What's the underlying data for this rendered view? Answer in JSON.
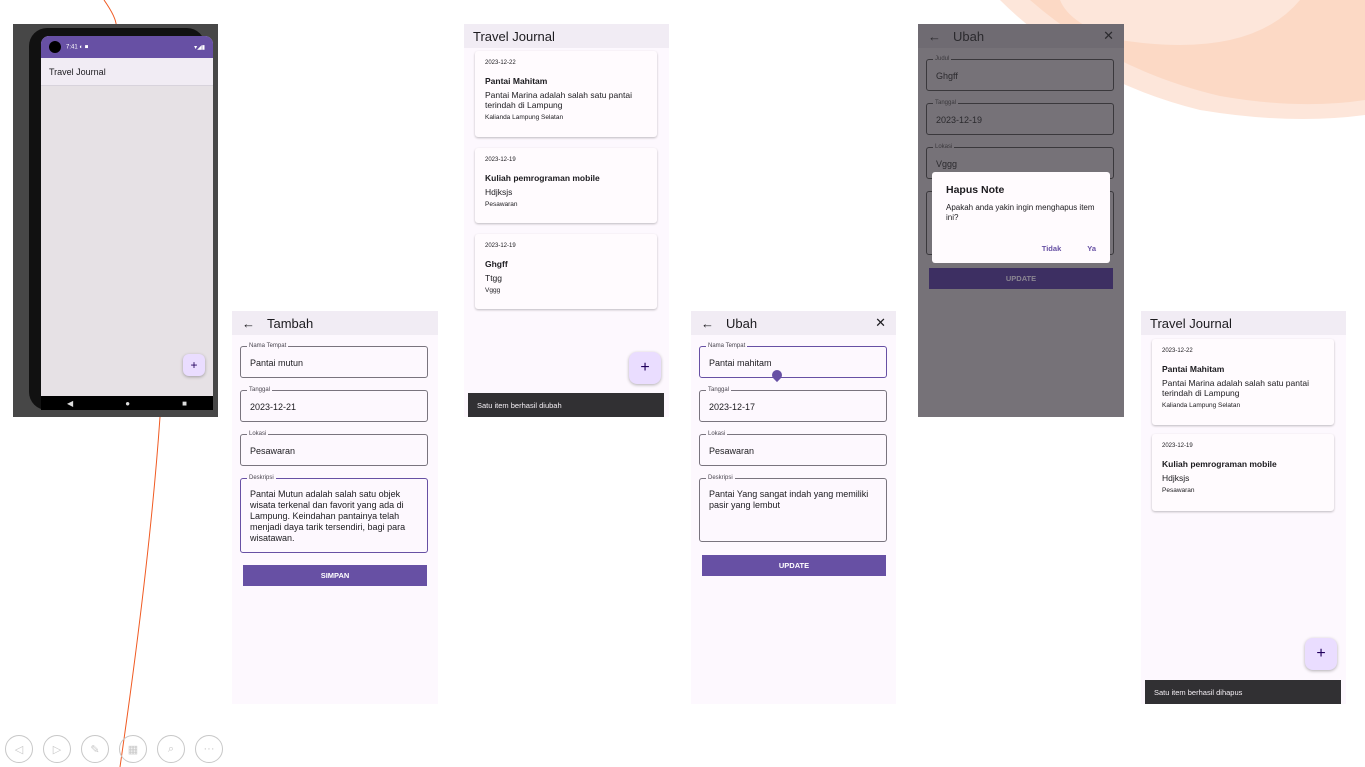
{
  "colors": {
    "primary": "#6750a4",
    "surface": "#fdf8fe",
    "appbar": "#f1ecf4",
    "fab": "#eaddff",
    "snackbar": "#313033",
    "accent_line": "#f05a22"
  },
  "phone1": {
    "time": "7:41",
    "status_icons": "◐ ■",
    "signal_icons": "▾◢▮",
    "app_title": "Travel Journal",
    "fab_label": "+",
    "nav_back": "◀",
    "nav_home": "●",
    "nav_recent": "■"
  },
  "add_screen": {
    "back_icon": "←",
    "title": "Tambah",
    "fields": [
      {
        "label": "Nama Tempat",
        "value": "Pantai mutun"
      },
      {
        "label": "Tanggal",
        "value": "2023-12-21"
      },
      {
        "label": "Lokasi",
        "value": "Pesawaran"
      },
      {
        "label": "Deskripsi",
        "value": "Pantai Mutun adalah salah satu objek wisata terkenal dan favorit yang ada di Lampung. Keindahan pantainya telah menjadi daya tarik tersendiri, bagi para wisatawan."
      }
    ],
    "button": "SIMPAN"
  },
  "list_screen_1": {
    "title": "Travel Journal",
    "cards": [
      {
        "date": "2023-12-22",
        "title": "Pantai Mahitam",
        "desc": "Pantai Marina adalah salah satu pantai terindah di Lampung",
        "loc": "Kalianda Lampung Selatan"
      },
      {
        "date": "2023-12-19",
        "title": "Kuliah pemrograman mobile",
        "desc": "Hdjksjs",
        "loc": "Pesawaran"
      },
      {
        "date": "2023-12-19",
        "title": "Ghgff",
        "desc": "Ttgg",
        "loc": "Vggg"
      }
    ],
    "fab_label": "+",
    "snackbar": "Satu item berhasil diubah"
  },
  "edit_screen": {
    "back_icon": "←",
    "title": "Ubah",
    "close_icon": "✕",
    "fields": [
      {
        "label": "Nama Tempat",
        "value": "Pantai mahitam"
      },
      {
        "label": "Tanggal",
        "value": "2023-12-17"
      },
      {
        "label": "Lokasi",
        "value": "Pesawaran"
      },
      {
        "label": "Deskripsi",
        "value": "Pantai Yang sangat indah yang memiliki pasir yang lembut"
      }
    ],
    "button": "UPDATE"
  },
  "dialog_screen": {
    "back_icon": "←",
    "title": "Ubah",
    "close_icon": "✕",
    "fields": [
      {
        "label": "Judul",
        "value": "Ghgff"
      },
      {
        "label": "Tanggal",
        "value": "2023-12-19"
      },
      {
        "label": "Lokasi",
        "value": "Vggg"
      }
    ],
    "button": "UPDATE",
    "dialog": {
      "title": "Hapus Note",
      "text": "Apakah anda yakin ingin menghapus item ini?",
      "cancel": "Tidak",
      "confirm": "Ya"
    }
  },
  "list_screen_2": {
    "title": "Travel Journal",
    "cards": [
      {
        "date": "2023-12-22",
        "title": "Pantai Mahitam",
        "desc": "Pantai Marina adalah salah satu pantai terindah di Lampung",
        "loc": "Kalianda Lampung Selatan"
      },
      {
        "date": "2023-12-19",
        "title": "Kuliah pemrograman mobile",
        "desc": "Hdjksjs",
        "loc": "Pesawaran"
      }
    ],
    "fab_label": "+",
    "snackbar": "Satu item berhasil dihapus"
  },
  "slideshow_toolbar": {
    "prev": "◁",
    "next": "▷",
    "pen": "✎",
    "slides": "▦",
    "zoom": "⌕",
    "more": "···"
  }
}
